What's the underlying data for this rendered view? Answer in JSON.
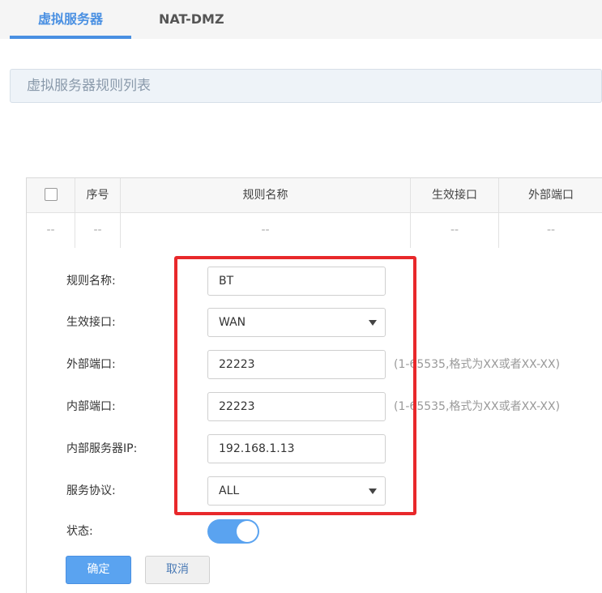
{
  "tabs": [
    {
      "label": "虚拟服务器",
      "active": true
    },
    {
      "label": "NAT-DMZ",
      "active": false
    }
  ],
  "section_title": "虚拟服务器规则列表",
  "table": {
    "headers": [
      "序号",
      "规则名称",
      "生效接口",
      "外部端口"
    ],
    "row": [
      "--",
      "--",
      "--",
      "--",
      "--"
    ]
  },
  "form": {
    "rule_name": {
      "label": "规则名称:",
      "value": "BT"
    },
    "interface": {
      "label": "生效接口:",
      "value": "WAN"
    },
    "external_port": {
      "label": "外部端口:",
      "value": "22223",
      "hint": "(1-65535,格式为XX或者XX-XX)"
    },
    "internal_port": {
      "label": "内部端口:",
      "value": "22223",
      "hint": "(1-65535,格式为XX或者XX-XX)"
    },
    "server_ip": {
      "label": "内部服务器IP:",
      "value": "192.168.1.13"
    },
    "protocol": {
      "label": "服务协议:",
      "value": "ALL"
    },
    "status": {
      "label": "状态:",
      "enabled": true
    }
  },
  "buttons": {
    "ok": "确定",
    "cancel": "取消"
  },
  "colors": {
    "accent": "#4a90e2",
    "highlight": "#e8282b",
    "toggle_on": "#5aa3f0"
  }
}
